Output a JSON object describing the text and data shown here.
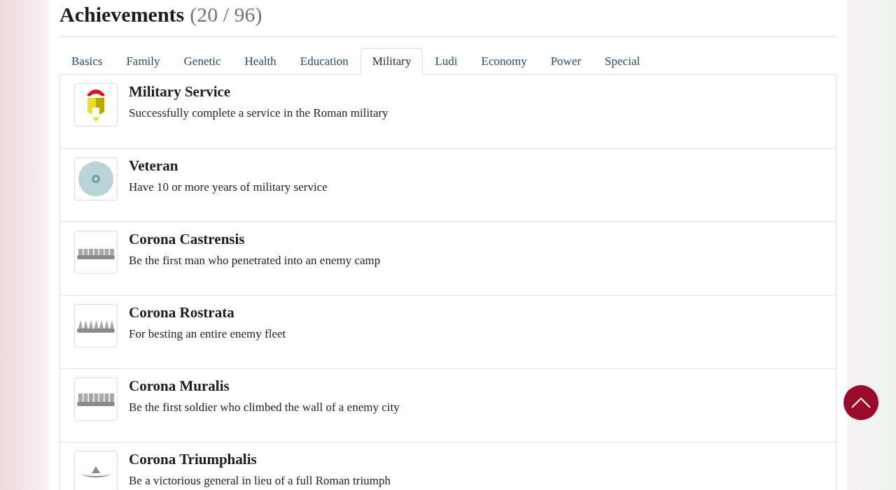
{
  "title": {
    "text": "Achievements",
    "count": "(20 / 96)"
  },
  "tabs": [
    {
      "label": "Basics",
      "selected": false
    },
    {
      "label": "Family",
      "selected": false
    },
    {
      "label": "Genetic",
      "selected": false
    },
    {
      "label": "Health",
      "selected": false
    },
    {
      "label": "Education",
      "selected": false
    },
    {
      "label": "Military",
      "selected": true
    },
    {
      "label": "Ludi",
      "selected": false
    },
    {
      "label": "Economy",
      "selected": false
    },
    {
      "label": "Power",
      "selected": false
    },
    {
      "label": "Special",
      "selected": false
    }
  ],
  "achievements": [
    {
      "kind": "helmet",
      "title": "Military Service",
      "description": "Successfully complete a service in the Roman military"
    },
    {
      "kind": "shield",
      "title": "Veteran",
      "description": "Have 10 or more years of military service"
    },
    {
      "kind": "palisade",
      "title": "Corona Castrensis",
      "description": "Be the first man who penetrated into an enemy camp"
    },
    {
      "kind": "ships",
      "title": "Corona Rostrata",
      "description": "For besting an entire enemy fleet"
    },
    {
      "kind": "wall",
      "title": "Corona Muralis",
      "description": "Be the first soldier who climbed the wall of a enemy city"
    },
    {
      "kind": "wreath",
      "title": "Corona Triumphalis",
      "description": "Be a victorious general in lieu of a full Roman triumph"
    }
  ]
}
